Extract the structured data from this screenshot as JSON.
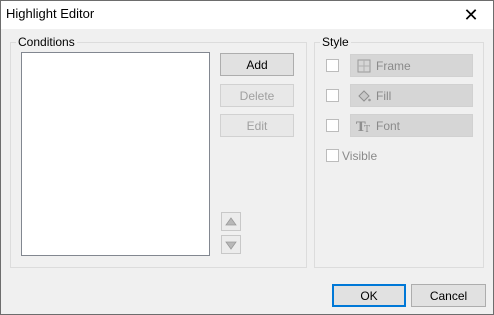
{
  "window": {
    "title": "Highlight Editor",
    "close_glyph": "✕"
  },
  "conditions": {
    "group_label": "Conditions",
    "items": [],
    "add_label": "Add",
    "delete_label": "Delete",
    "edit_label": "Edit",
    "move_up_icon": "arrow-up-icon",
    "move_down_icon": "arrow-down-icon"
  },
  "style": {
    "group_label": "Style",
    "frame_label": "Frame",
    "fill_label": "Fill",
    "font_label": "Font",
    "visible_label": "Visible",
    "frame_checked": false,
    "fill_checked": false,
    "font_checked": false,
    "visible_checked": false
  },
  "footer": {
    "ok_label": "OK",
    "cancel_label": "Cancel"
  },
  "colors": {
    "accent": "#0078d7",
    "disabled_text": "#8a8a8a"
  }
}
